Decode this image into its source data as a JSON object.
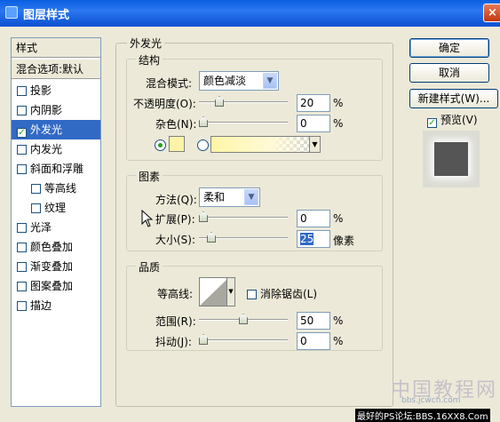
{
  "window": {
    "title": "图层样式",
    "close_glyph": "×"
  },
  "style_list": {
    "header": "样式",
    "blend_item": "混合选项:默认",
    "items": [
      {
        "label": "投影",
        "checked": false
      },
      {
        "label": "内阴影",
        "checked": false
      },
      {
        "label": "外发光",
        "checked": true,
        "selected": true
      },
      {
        "label": "内发光",
        "checked": false
      },
      {
        "label": "斜面和浮雕",
        "checked": false
      },
      {
        "label": "等高线",
        "checked": false,
        "sub": true
      },
      {
        "label": "纹理",
        "checked": false,
        "sub": true
      },
      {
        "label": "光泽",
        "checked": false
      },
      {
        "label": "颜色叠加",
        "checked": false
      },
      {
        "label": "渐变叠加",
        "checked": false
      },
      {
        "label": "图案叠加",
        "checked": false
      },
      {
        "label": "描边",
        "checked": false
      }
    ],
    "check_glyph": "✓"
  },
  "outer_glow": {
    "title": "外发光",
    "structure": {
      "title": "结构",
      "blend_mode_label": "混合模式:",
      "blend_mode_value": "颜色减淡",
      "opacity_label": "不透明度(O):",
      "opacity_value": "20",
      "opacity_fraction": 0.2,
      "noise_label": "杂色(N):",
      "noise_value": "0",
      "noise_fraction": 0.0,
      "unit": "%",
      "color_swatch": "#fff3a8"
    },
    "elements": {
      "title": "图素",
      "method_label": "方法(Q):",
      "method_value": "柔和",
      "spread_label": "扩展(P):",
      "spread_value": "0",
      "spread_fraction": 0.0,
      "size_label": "大小(S):",
      "size_value": "25",
      "size_fraction": 0.1,
      "size_unit": "像素",
      "unit": "%"
    },
    "quality": {
      "title": "品质",
      "contour_label": "等高线:",
      "antialias_label": "消除锯齿(L)",
      "range_label": "范围(R):",
      "range_value": "50",
      "range_fraction": 0.5,
      "jitter_label": "抖动(J):",
      "jitter_value": "0",
      "jitter_fraction": 0.0,
      "unit": "%"
    }
  },
  "buttons": {
    "ok": "确定",
    "cancel": "取消",
    "new_style": "新建样式(W)...",
    "preview_label": "预览(V)",
    "preview_checked": true
  },
  "watermark": {
    "line1": "中国教程网",
    "line2": "bbs.jcwcn.com",
    "line3": "最好的PS论坛:BBS.16XX8.Com"
  },
  "colors": {
    "selection": "#316ac5",
    "titlebar": "#0a5fe0",
    "dialog_bg": "#ece9d8"
  }
}
